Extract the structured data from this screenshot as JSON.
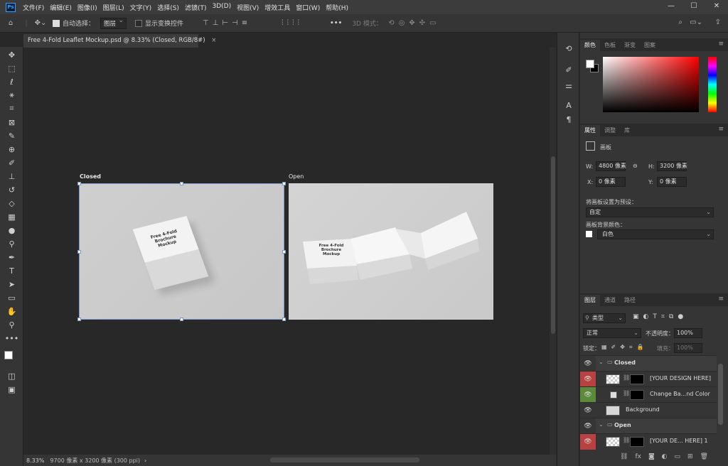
{
  "app": {
    "logo": "Ps"
  },
  "menu": [
    "文件(F)",
    "编辑(E)",
    "图像(I)",
    "图层(L)",
    "文字(Y)",
    "选择(S)",
    "滤镜(T)",
    "3D(D)",
    "视图(V)",
    "增效工具",
    "窗口(W)",
    "帮助(H)"
  ],
  "window_controls": {
    "minimize": "—",
    "maximize": "☐",
    "close": "✕"
  },
  "options": {
    "auto_select_label": "自动选择：",
    "auto_select_value": "图层",
    "show_transform_label": "显示变换控件",
    "mode_3d_label": "3D 模式：",
    "more": "•••"
  },
  "document_tab": {
    "title": "Free 4-Fold Leaflet Mockup.psd @ 8.33% (Closed, RGB/8#)",
    "close": "×"
  },
  "artboards": {
    "closed_label": "Closed",
    "open_label": "Open",
    "brochure_text": [
      "Free 4-Fold",
      "Brochure",
      "Mockup"
    ]
  },
  "status": {
    "zoom": "8.33%",
    "doc_info": "9700 像素 x 3200 像素 (300 ppi)",
    "arrow": "›"
  },
  "color_panel": {
    "tabs": [
      "颜色",
      "色板",
      "渐变",
      "图案"
    ],
    "active": 0
  },
  "properties_panel": {
    "tabs": [
      "属性",
      "调整",
      "库"
    ],
    "active": 0,
    "section_title": "画板",
    "w_label": "W:",
    "w_value": "4800 像素",
    "h_label": "H:",
    "h_value": "3200 像素",
    "x_label": "X:",
    "x_value": "0 像素",
    "y_label": "Y:",
    "y_value": "0 像素",
    "preset_label": "将画板设置为预设：",
    "preset_value": "自定",
    "bg_label": "画板背景颜色：",
    "bg_value": "白色"
  },
  "layers_panel": {
    "tabs": [
      "图层",
      "通道",
      "路径"
    ],
    "active": 0,
    "filter_kind": "类型",
    "blend_mode": "正常",
    "opacity_label": "不透明度：",
    "opacity_value": "100%",
    "lock_label": "锁定：",
    "fill_label": "填充：",
    "fill_value": "100%",
    "layers": [
      {
        "name": "Closed",
        "type": "group",
        "eye_color": "#353535"
      },
      {
        "name": "[YOUR DESIGN HERE]",
        "type": "smart",
        "eye_color": "#b84242"
      },
      {
        "name": "Change Ba...nd Color",
        "type": "fill",
        "eye_color": "#5a8a3a"
      },
      {
        "name": "Background",
        "type": "image",
        "eye_color": "#353535"
      },
      {
        "name": "Open",
        "type": "group",
        "eye_color": "#353535"
      },
      {
        "name": "[YOUR DE... HERE] 1",
        "type": "smart",
        "eye_color": "#b84242"
      }
    ],
    "footer_icons": [
      "link-icon",
      "fx-icon",
      "mask-icon",
      "adjustment-icon",
      "folder-icon",
      "new-layer-icon",
      "trash-icon"
    ]
  },
  "colors": {
    "accent": "#7b98d6",
    "foreground": "#ffffff",
    "background_swatch": "#000000"
  }
}
